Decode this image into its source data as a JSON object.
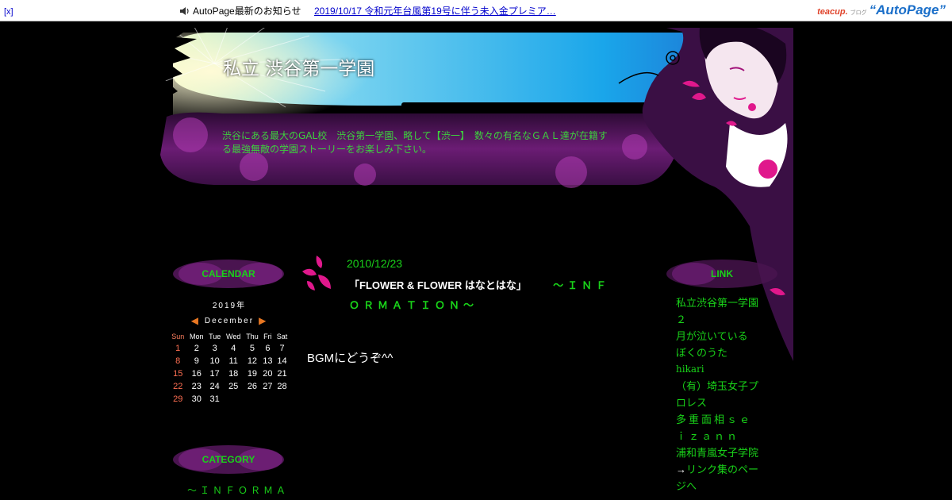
{
  "topbar": {
    "close_label": "[x]",
    "notice_label": "AutoPage最新のお知らせ",
    "news_link": "2019/10/17 令和元年台風第19号に伴う未入金プレミア…",
    "logo_teacup": "teacup.",
    "logo_blog": "ブログ",
    "logo_autopage": "“AutoPage”",
    "icon": "speaker-icon"
  },
  "header": {
    "site_title": "私立 渋谷第一学園",
    "description": "渋谷にある最大のGAL校　渋谷第一学園、略して【渋一】　数々の有名なＧＡＬ達が在籍する最強無敵の学園ストーリーをお楽しみ下さい。"
  },
  "calendar": {
    "heading": "CALENDAR",
    "year_label": "2019年",
    "month_label": "December",
    "prev_icon": "◀",
    "next_icon": "▶",
    "weekdays": [
      "Sun",
      "Mon",
      "Tue",
      "Wed",
      "Thu",
      "Fri",
      "Sat"
    ],
    "weeks": [
      [
        "1",
        "2",
        "3",
        "4",
        "5",
        "6",
        "7"
      ],
      [
        "8",
        "9",
        "10",
        "11",
        "12",
        "13",
        "14"
      ],
      [
        "15",
        "16",
        "17",
        "18",
        "19",
        "20",
        "21"
      ],
      [
        "22",
        "23",
        "24",
        "25",
        "26",
        "27",
        "28"
      ],
      [
        "29",
        "30",
        "31",
        "",
        "",
        "",
        ""
      ]
    ]
  },
  "category": {
    "heading": "CATEGORY",
    "first_item": "～ＩＮＦＯＲＭＡ"
  },
  "post": {
    "date": "2010/12/23",
    "title_part1": "「FLOWER & FLOWER はなとはな」",
    "title_part2": "～ＩＮＦＯＲＭＡＴＩＯＮ～",
    "body": "BGMにどうぞ^^"
  },
  "links": {
    "heading": "LINK",
    "items": [
      "私立渋谷第一学園２",
      "月が泣いている",
      "ぼくのうた",
      "hikari",
      "（有）埼玉女子プロレス",
      "多重面相ｓｅｉｚａｎｎ",
      "浦和青嵐女子学院"
    ],
    "arrow_prefix": "→",
    "last_item": "リンク集のページへ"
  },
  "colors": {
    "accent_green": "#19d219",
    "magenta": "#e0188c",
    "purple": "#5a1660",
    "sky": "#2fa6e6"
  }
}
